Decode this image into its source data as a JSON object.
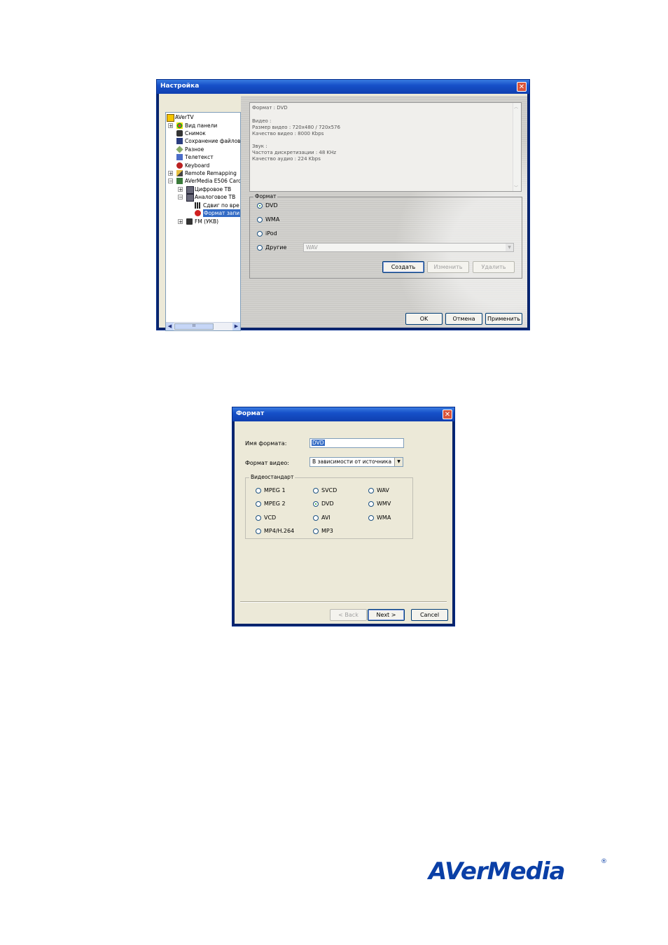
{
  "settings_window": {
    "title": "Настройка",
    "tree": [
      {
        "label": "AVerTV",
        "icon": "avertv-icon"
      },
      {
        "label": "Вид панели",
        "icon": "panel-icon"
      },
      {
        "label": "Снимок",
        "icon": "camera-icon"
      },
      {
        "label": "Сохранение файлов",
        "icon": "save-icon"
      },
      {
        "label": "Разное",
        "icon": "misc-icon"
      },
      {
        "label": "Телетекст",
        "icon": "teletext-icon"
      },
      {
        "label": "Keyboard",
        "icon": "keyboard-icon"
      },
      {
        "label": "Remote Remapping",
        "icon": "remote-icon"
      },
      {
        "label": "AVerMedia E506 Carc",
        "icon": "card-icon"
      },
      {
        "label": "Цифровое ТВ",
        "icon": "tv-icon"
      },
      {
        "label": "Аналоговое ТВ",
        "icon": "tv-icon"
      },
      {
        "label": "Сдвиг по вре",
        "icon": "timeshift-icon"
      },
      {
        "label": "Формат запи",
        "icon": "record-icon"
      },
      {
        "label": "FM (УКВ)",
        "icon": "radio-icon"
      }
    ],
    "scroll_thumb_glyph": "III",
    "info_lines": [
      "Формат : DVD",
      "",
      "Видео :",
      "Размер видео : 720x480 / 720x576",
      "Качество видео : 8000 Kbps",
      "",
      "Звук :",
      "Частота дискретизации : 48 KHz",
      "Качество аудио : 224 Kbps"
    ],
    "format_group_label": "Формат",
    "format_options": [
      {
        "label": "DVD",
        "selected": true
      },
      {
        "label": "WMA",
        "selected": false
      },
      {
        "label": "iPod",
        "selected": false
      },
      {
        "label": "Другие",
        "selected": false
      }
    ],
    "other_combo_value": "WAV",
    "buttons": {
      "create": "Создать",
      "edit": "Изменить",
      "delete": "Удалить",
      "ok": "OK",
      "cancel": "Отмена",
      "apply": "Применить"
    }
  },
  "format_dialog": {
    "title": "Формат",
    "name_label": "Имя формата:",
    "name_value": "DVD",
    "video_format_label": "Формат видео:",
    "video_format_value": "В зависимости от источника",
    "standard_group_label": "Видеостандарт",
    "standards": [
      [
        {
          "label": "MPEG 1",
          "selected": false
        },
        {
          "label": "SVCD",
          "selected": false
        },
        {
          "label": "WAV",
          "selected": false
        }
      ],
      [
        {
          "label": "MPEG 2",
          "selected": false
        },
        {
          "label": "DVD",
          "selected": true
        },
        {
          "label": "WMV",
          "selected": false
        }
      ],
      [
        {
          "label": "VCD",
          "selected": false
        },
        {
          "label": "AVI",
          "selected": false
        },
        {
          "label": "WMA",
          "selected": false
        }
      ],
      [
        {
          "label": "MP4/H.264",
          "selected": false
        },
        {
          "label": "MP3",
          "selected": false
        }
      ]
    ],
    "buttons": {
      "back": "< Back",
      "next": "Next >",
      "cancel": "Cancel"
    }
  },
  "logo": {
    "text": "AVerMedia",
    "registered": "®"
  },
  "colors": {
    "title_bar": "#1650c8",
    "dialog_bg": "#ece9d8",
    "logo": "#0a3fa6"
  }
}
